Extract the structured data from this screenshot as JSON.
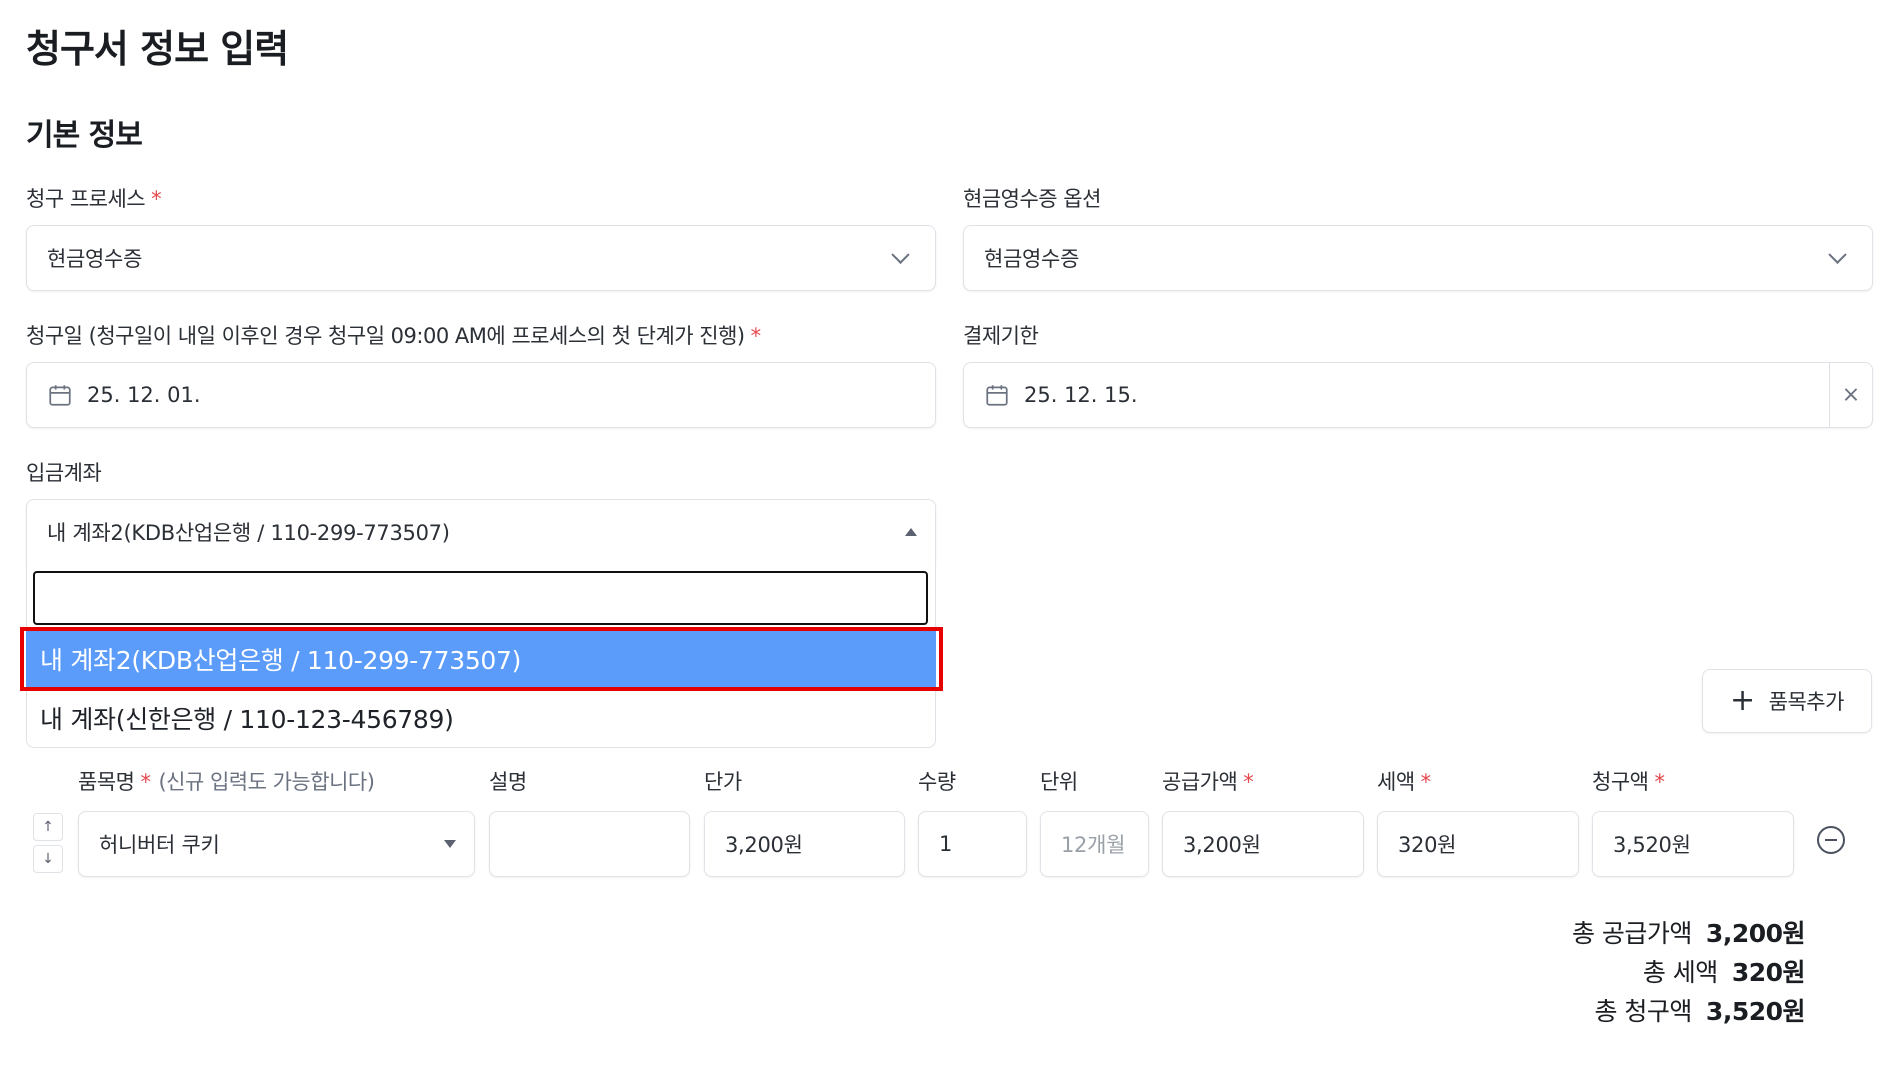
{
  "page": {
    "title": "청구서 정보 입력"
  },
  "section": {
    "title": "기본 정보"
  },
  "billing_process": {
    "label": "청구 프로세스",
    "required": "*",
    "value": "현금영수증"
  },
  "cash_receipt_option": {
    "label": "현금영수증 옵션",
    "value": "현금영수증"
  },
  "billing_date": {
    "label": "청구일 (청구일이 내일 이후인 경우 청구일 09:00 AM에 프로세스의 첫 단계가 진행)",
    "required": "*",
    "value": "25. 12. 01."
  },
  "due_date": {
    "label": "결제기한",
    "value": "25. 12. 15.",
    "clear_icon": "×"
  },
  "deposit_account": {
    "label": "입금계좌",
    "value": "내 계좌2(KDB산업은행 / 110-299-773507)",
    "search_value": "",
    "options": [
      {
        "label": "내 계좌2(KDB산업은행 / 110-299-773507)",
        "selected": true
      },
      {
        "label": "내 계좌(신한은행 / 110-123-456789)",
        "selected": false
      }
    ]
  },
  "add_item": {
    "icon": "+",
    "label": "품목추가"
  },
  "items_table": {
    "headers": {
      "item_name": "품목명",
      "item_name_required": "*",
      "item_name_hint": "(신규 입력도 가능합니다)",
      "description": "설명",
      "unit_price": "단가",
      "quantity": "수량",
      "unit": "단위",
      "supply_amount": "공급가액",
      "supply_required": "*",
      "tax": "세액",
      "tax_required": "*",
      "billing_amount": "청구액",
      "billing_required": "*"
    },
    "rows": [
      {
        "item_name": "허니버터 쿠키",
        "description": "",
        "unit_price": "3,200원",
        "quantity": "1",
        "unit_placeholder": "12개월",
        "supply_amount": "3,200원",
        "tax": "320원",
        "billing_amount": "3,520원",
        "move_up": "↑",
        "move_down": "↓"
      }
    ]
  },
  "totals": {
    "supply_label": "총 공급가액",
    "supply_value": "3,200원",
    "tax_label": "총 세액",
    "tax_value": "320원",
    "billing_label": "총 청구액",
    "billing_value": "3,520원"
  },
  "colors": {
    "selected_option": "#5b9bf9",
    "highlight": "#e60000",
    "required": "#e5484d"
  }
}
